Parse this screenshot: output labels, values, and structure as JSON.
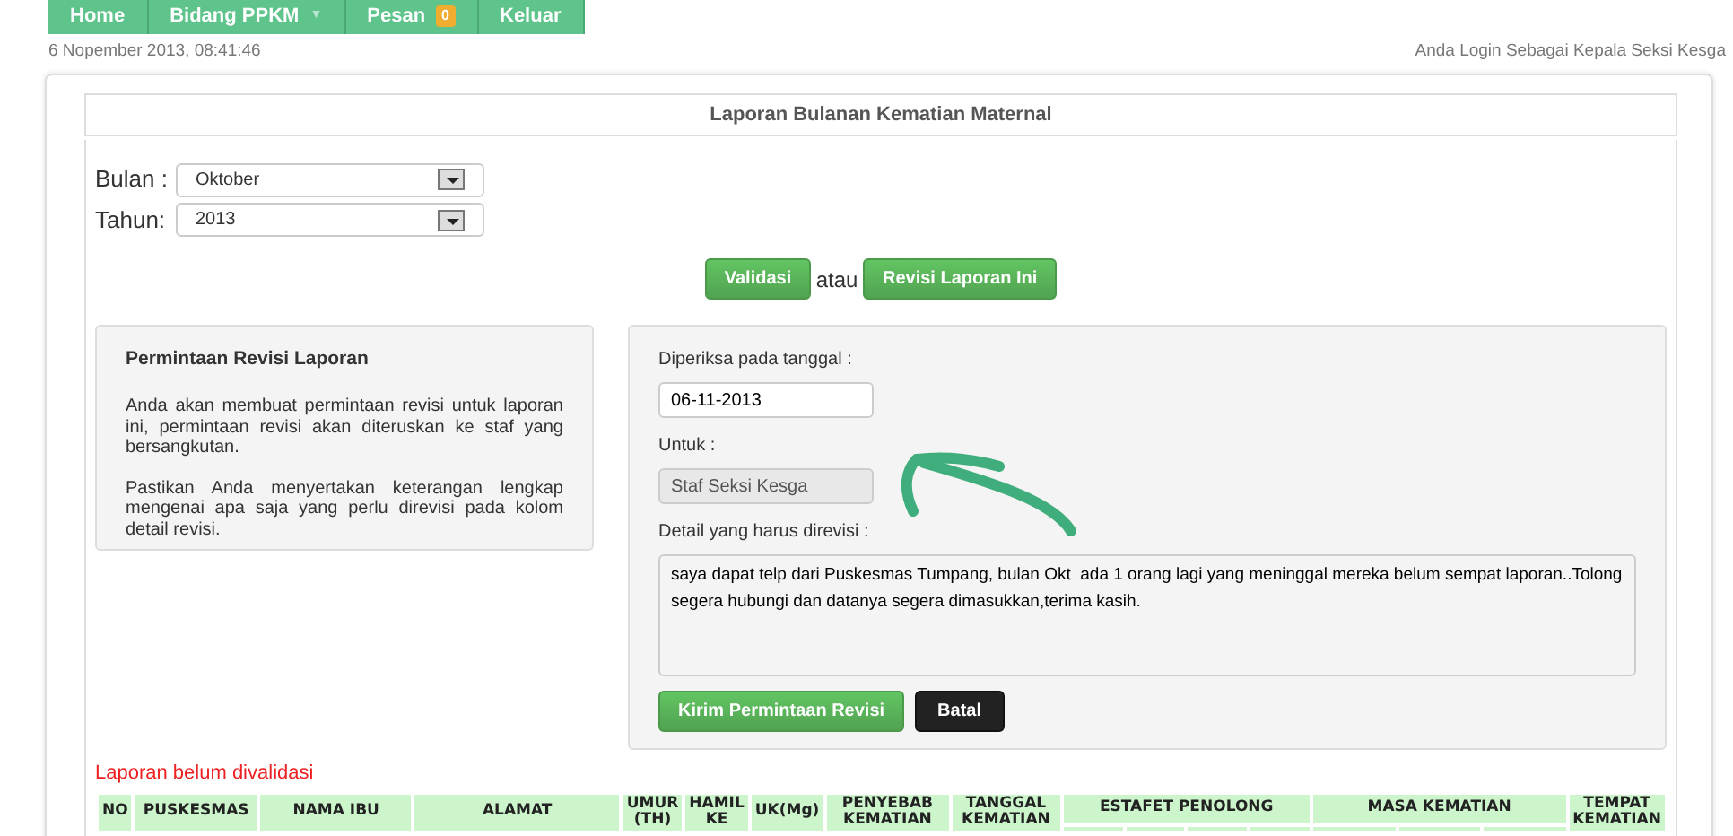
{
  "nav": [
    {
      "label": "Home",
      "kind": "link"
    },
    {
      "label": "Bidang PPKM",
      "kind": "dropdown",
      "caret": "▼"
    },
    {
      "label": "Pesan",
      "kind": "badge",
      "badge": "0"
    },
    {
      "label": "Keluar",
      "kind": "link"
    }
  ],
  "datetime": "6 Nopember 2013, 08:41:46",
  "login_info": "Anda Login Sebagai Kepala Seksi Kesga",
  "title": "Laporan Bulanan Kematian Maternal",
  "filters": [
    {
      "label": "Bulan :",
      "value": "Oktober"
    },
    {
      "label": "Tahun:",
      "value": "2013"
    }
  ],
  "actions": {
    "validate": "Validasi",
    "or": "atau",
    "revise": "Revisi Laporan Ini"
  },
  "info": {
    "heading": "Permintaan Revisi Laporan",
    "paragraphs": [
      "Anda akan membuat permintaan revisi untuk laporan ini, permintaan revisi akan diteruskan ke staf yang bersangkutan.",
      "Pastikan Anda menyertakan keterangan lengkap mengenai apa saja yang perlu direvisi pada kolom detail revisi."
    ]
  },
  "form": {
    "fields": [
      {
        "label": "Diperiksa pada tanggal :",
        "value": "06-11-2013",
        "kind": "input",
        "disabled": false
      },
      {
        "label": "Untuk :",
        "value": "Staf Seksi Kesga",
        "kind": "input",
        "disabled": true
      },
      {
        "label": "Detail yang harus direvisi :",
        "value": "saya dapat telp dari Puskesmas Tumpang, bulan Okt  ada 1 orang lagi yang meninggal mereka belum sempat laporan..Tolong segera hubungi dan datanya segera dimasukkan,terima kasih.",
        "kind": "textarea",
        "disabled": false
      }
    ],
    "submit": "Kirim Permintaan Revisi",
    "cancel": "Batal"
  },
  "table": {
    "status": "Laporan belum divalidasi",
    "columns": [
      {
        "label": "NO",
        "kind": "single"
      },
      {
        "label": "PUSKESMAS",
        "kind": "single"
      },
      {
        "label": "NAMA IBU",
        "kind": "single"
      },
      {
        "label": "ALAMAT",
        "kind": "single"
      },
      {
        "label": "UMUR (TH)",
        "kind": "single"
      },
      {
        "label": "HAMIL KE",
        "kind": "single"
      },
      {
        "label": "UK(Mg)",
        "kind": "single"
      },
      {
        "label": "PENYEBAB KEMATIAN",
        "kind": "single"
      },
      {
        "label": "TANGGAL KEMATIAN",
        "kind": "single"
      },
      {
        "label": "ESTAFET PENOLONG",
        "kind": "group"
      },
      {
        "label": "MASA KEMATIAN",
        "kind": "group"
      },
      {
        "label": "TEMPAT KEMATIAN",
        "kind": "single"
      }
    ]
  }
}
